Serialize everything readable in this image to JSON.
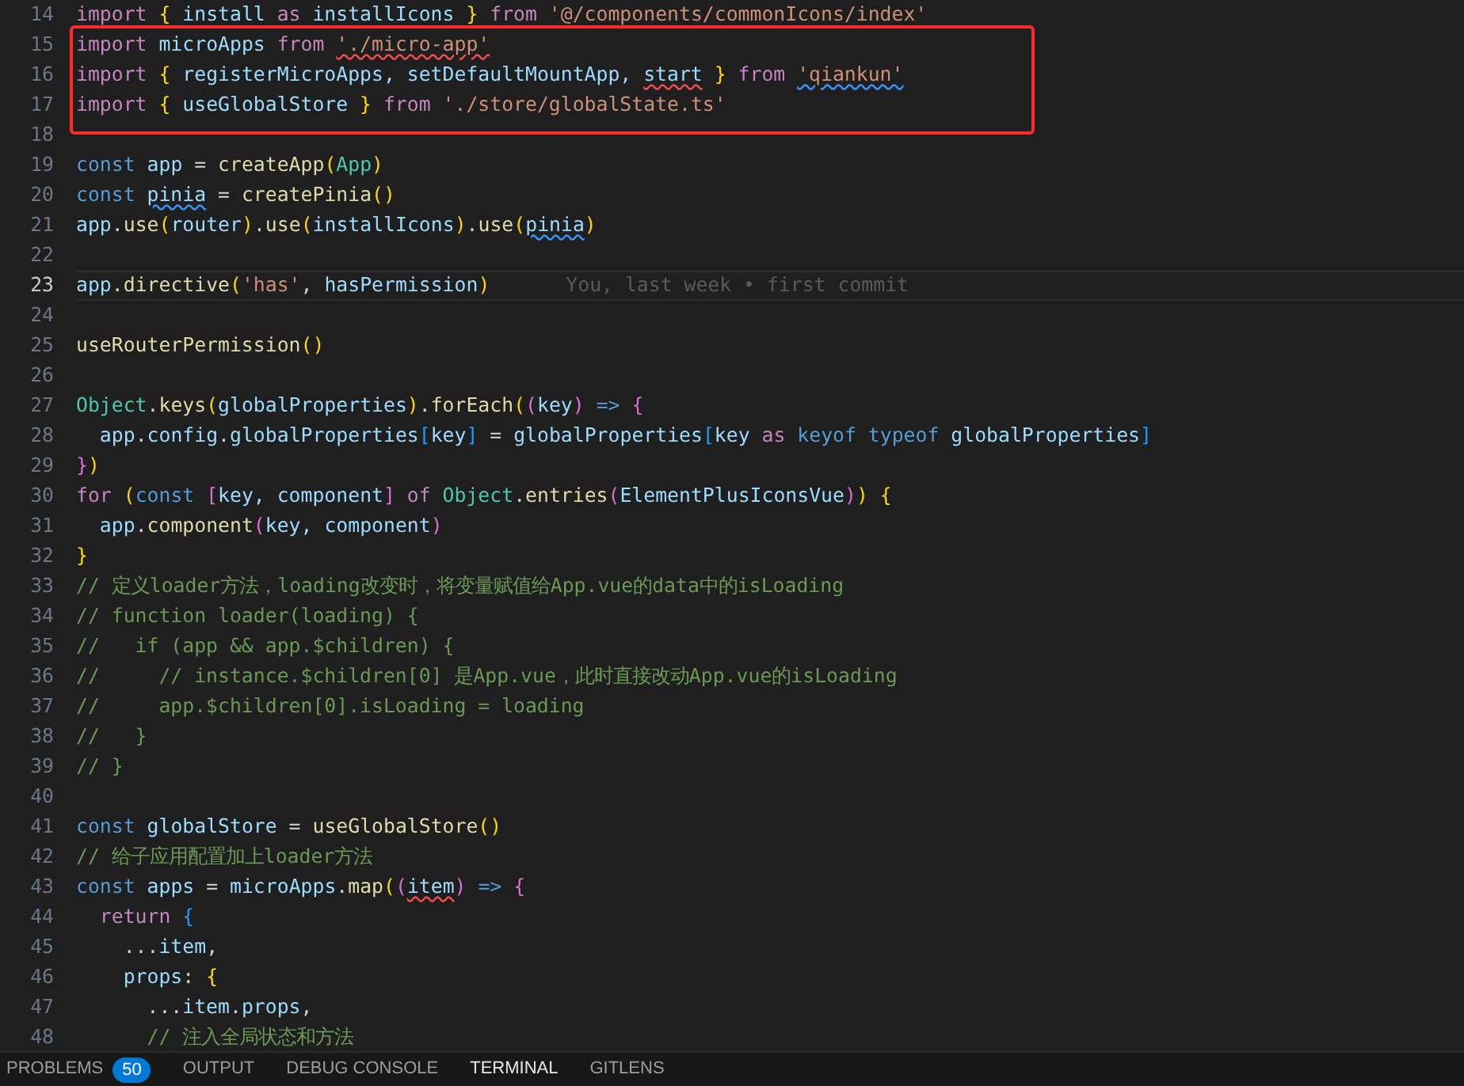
{
  "editor": {
    "blocks": [
      {
        "framed": false,
        "lines": [
          {
            "number": "14",
            "current": false,
            "tokens": [
              {
                "t": "import",
                "kind": "control"
              },
              {
                "t": " {",
                "kind": "bracket1"
              },
              {
                "t": " install ",
                "kind": "variable"
              },
              {
                "t": "as",
                "kind": "control"
              },
              {
                "t": " installIcons ",
                "kind": "variable"
              },
              {
                "t": "}",
                "kind": "bracket1"
              },
              {
                "t": " from",
                "kind": "control"
              },
              {
                "t": " '@/components/commonIcons/index'",
                "kind": "string"
              }
            ]
          }
        ]
      },
      {
        "framed": true,
        "lines": [
          {
            "number": "15",
            "current": false,
            "tokens": [
              {
                "t": "import",
                "kind": "control"
              },
              {
                "t": " microApps",
                "kind": "variable"
              },
              {
                "t": " from ",
                "kind": "control"
              },
              {
                "t": "'./micro-app'",
                "kind": "string",
                "error": true
              }
            ]
          },
          {
            "number": "16",
            "current": false,
            "tokens": [
              {
                "t": "import",
                "kind": "control"
              },
              {
                "t": " {",
                "kind": "bracket1"
              },
              {
                "t": " registerMicroApps, setDefaultMountApp, ",
                "kind": "variable"
              },
              {
                "t": "start",
                "kind": "variable",
                "error": true
              },
              {
                "t": " }",
                "kind": "bracket1"
              },
              {
                "t": " from ",
                "kind": "control"
              },
              {
                "t": "'qiankun'",
                "kind": "string",
                "warning": true
              }
            ]
          },
          {
            "number": "17",
            "current": false,
            "tokens": [
              {
                "t": "import",
                "kind": "control"
              },
              {
                "t": " {",
                "kind": "bracket1"
              },
              {
                "t": " useGlobalStore",
                "kind": "variable"
              },
              {
                "t": " }",
                "kind": "bracket1"
              },
              {
                "t": " from",
                "kind": "control"
              },
              {
                "t": " './store/globalState.ts'",
                "kind": "string"
              }
            ]
          }
        ]
      },
      {
        "framed": false,
        "lines": [
          {
            "number": "18",
            "current": false
          },
          {
            "number": "19",
            "current": false,
            "tokens": [
              {
                "t": "const",
                "kind": "keyword"
              },
              {
                "t": " app",
                "kind": "variable"
              },
              {
                "t": " = ",
                "kind": "plain"
              },
              {
                "t": "createApp",
                "kind": "function"
              },
              {
                "t": "(",
                "kind": "bracket1"
              },
              {
                "t": "App",
                "kind": "type"
              },
              {
                "t": ")",
                "kind": "bracket1"
              }
            ]
          },
          {
            "number": "20",
            "current": false,
            "tokens": [
              {
                "t": "const ",
                "kind": "keyword"
              },
              {
                "t": "pinia",
                "kind": "variable",
                "warning": true
              },
              {
                "t": " = ",
                "kind": "plain"
              },
              {
                "t": "createPinia",
                "kind": "function"
              },
              {
                "t": "()",
                "kind": "bracket1"
              }
            ]
          },
          {
            "number": "21",
            "current": false,
            "tokens": [
              {
                "t": "app",
                "kind": "variable"
              },
              {
                "t": ".",
                "kind": "plain"
              },
              {
                "t": "use",
                "kind": "function"
              },
              {
                "t": "(",
                "kind": "bracket1"
              },
              {
                "t": "router",
                "kind": "variable"
              },
              {
                "t": ")",
                "kind": "bracket1"
              },
              {
                "t": ".",
                "kind": "plain"
              },
              {
                "t": "use",
                "kind": "function"
              },
              {
                "t": "(",
                "kind": "bracket1"
              },
              {
                "t": "installIcons",
                "kind": "variable"
              },
              {
                "t": ")",
                "kind": "bracket1"
              },
              {
                "t": ".",
                "kind": "plain"
              },
              {
                "t": "use",
                "kind": "function"
              },
              {
                "t": "(",
                "kind": "bracket1"
              },
              {
                "t": "pinia",
                "kind": "variable",
                "warning": true
              },
              {
                "t": ")",
                "kind": "bracket1"
              }
            ]
          },
          {
            "number": "22",
            "current": false
          },
          {
            "number": "23",
            "current": true,
            "blame": "You, last week • first commit",
            "tokens": [
              {
                "t": "app",
                "kind": "variable"
              },
              {
                "t": ".",
                "kind": "plain"
              },
              {
                "t": "directive",
                "kind": "function"
              },
              {
                "t": "(",
                "kind": "bracket1"
              },
              {
                "t": "'has'",
                "kind": "string"
              },
              {
                "t": ",",
                "kind": "plain"
              },
              {
                "t": " hasPermission",
                "kind": "variable"
              },
              {
                "t": ")",
                "kind": "bracket1"
              }
            ]
          },
          {
            "number": "24",
            "current": false
          },
          {
            "number": "25",
            "current": false,
            "tokens": [
              {
                "t": "useRouterPermission",
                "kind": "function"
              },
              {
                "t": "()",
                "kind": "bracket1"
              }
            ]
          },
          {
            "number": "26",
            "current": false
          },
          {
            "number": "27",
            "current": false,
            "tokens": [
              {
                "t": "Object",
                "kind": "type"
              },
              {
                "t": ".",
                "kind": "plain"
              },
              {
                "t": "keys",
                "kind": "function"
              },
              {
                "t": "(",
                "kind": "bracket1"
              },
              {
                "t": "globalProperties",
                "kind": "variable"
              },
              {
                "t": ")",
                "kind": "bracket1"
              },
              {
                "t": ".",
                "kind": "plain"
              },
              {
                "t": "forEach",
                "kind": "function"
              },
              {
                "t": "(",
                "kind": "bracket1"
              },
              {
                "t": "(",
                "kind": "bracket2"
              },
              {
                "t": "key",
                "kind": "variable"
              },
              {
                "t": ")",
                "kind": "bracket2"
              },
              {
                "t": " =>",
                "kind": "keyword"
              },
              {
                "t": " {",
                "kind": "bracket2"
              }
            ]
          },
          {
            "number": "28",
            "current": false,
            "tokens": [
              {
                "t": "  app",
                "kind": "variable"
              },
              {
                "t": ".",
                "kind": "plain"
              },
              {
                "t": "config",
                "kind": "variable"
              },
              {
                "t": ".",
                "kind": "plain"
              },
              {
                "t": "globalProperties",
                "kind": "variable"
              },
              {
                "t": "[",
                "kind": "bracket3"
              },
              {
                "t": "key",
                "kind": "variable"
              },
              {
                "t": "]",
                "kind": "bracket3"
              },
              {
                "t": " = ",
                "kind": "plain"
              },
              {
                "t": "globalProperties",
                "kind": "variable"
              },
              {
                "t": "[",
                "kind": "bracket3"
              },
              {
                "t": "key",
                "kind": "variable"
              },
              {
                "t": " as",
                "kind": "control"
              },
              {
                "t": " keyof typeof",
                "kind": "keyword"
              },
              {
                "t": " globalProperties",
                "kind": "variable"
              },
              {
                "t": "]",
                "kind": "bracket3"
              }
            ]
          },
          {
            "number": "29",
            "current": false,
            "tokens": [
              {
                "t": "}",
                "kind": "bracket2"
              },
              {
                "t": ")",
                "kind": "bracket1"
              }
            ]
          },
          {
            "number": "30",
            "current": false,
            "tokens": [
              {
                "t": "for",
                "kind": "control"
              },
              {
                "t": " (",
                "kind": "bracket1"
              },
              {
                "t": "const",
                "kind": "keyword"
              },
              {
                "t": " [",
                "kind": "bracket2"
              },
              {
                "t": "key, component",
                "kind": "variable"
              },
              {
                "t": "]",
                "kind": "bracket2"
              },
              {
                "t": " of",
                "kind": "control"
              },
              {
                "t": " Object",
                "kind": "type"
              },
              {
                "t": ".",
                "kind": "plain"
              },
              {
                "t": "entries",
                "kind": "function"
              },
              {
                "t": "(",
                "kind": "bracket2"
              },
              {
                "t": "ElementPlusIconsVue",
                "kind": "variable"
              },
              {
                "t": ")",
                "kind": "bracket2"
              },
              {
                "t": ")",
                "kind": "bracket1"
              },
              {
                "t": " {",
                "kind": "bracket1"
              }
            ]
          },
          {
            "number": "31",
            "current": false,
            "tokens": [
              {
                "t": "  app",
                "kind": "variable"
              },
              {
                "t": ".",
                "kind": "plain"
              },
              {
                "t": "component",
                "kind": "function"
              },
              {
                "t": "(",
                "kind": "bracket2"
              },
              {
                "t": "key, component",
                "kind": "variable"
              },
              {
                "t": ")",
                "kind": "bracket2"
              }
            ]
          },
          {
            "number": "32",
            "current": false,
            "tokens": [
              {
                "t": "}",
                "kind": "bracket1"
              }
            ]
          },
          {
            "number": "33",
            "current": false,
            "tokens": [
              {
                "t": "// 定义loader方法，loading改变时，将变量赋值给App.vue的data中的isLoading",
                "kind": "comment"
              }
            ]
          },
          {
            "number": "34",
            "current": false,
            "tokens": [
              {
                "t": "// function loader(loading) {",
                "kind": "comment"
              }
            ]
          },
          {
            "number": "35",
            "current": false,
            "tokens": [
              {
                "t": "//   if (app && app.$children) {",
                "kind": "comment"
              }
            ]
          },
          {
            "number": "36",
            "current": false,
            "tokens": [
              {
                "t": "//     // instance.$children[0] 是App.vue，此时直接改动App.vue的isLoading",
                "kind": "comment"
              }
            ]
          },
          {
            "number": "37",
            "current": false,
            "tokens": [
              {
                "t": "//     app.$children[0].isLoading = loading",
                "kind": "comment"
              }
            ]
          },
          {
            "number": "38",
            "current": false,
            "tokens": [
              {
                "t": "//   }",
                "kind": "comment"
              }
            ]
          },
          {
            "number": "39",
            "current": false,
            "tokens": [
              {
                "t": "// }",
                "kind": "comment"
              }
            ]
          },
          {
            "number": "40",
            "current": false
          },
          {
            "number": "41",
            "current": false,
            "tokens": [
              {
                "t": "const",
                "kind": "keyword"
              },
              {
                "t": " globalStore",
                "kind": "variable"
              },
              {
                "t": " = ",
                "kind": "plain"
              },
              {
                "t": "useGlobalStore",
                "kind": "function"
              },
              {
                "t": "()",
                "kind": "bracket1"
              }
            ]
          },
          {
            "number": "42",
            "current": false,
            "tokens": [
              {
                "t": "// 给子应用配置加上loader方法",
                "kind": "comment"
              }
            ]
          },
          {
            "number": "43",
            "current": false,
            "tokens": [
              {
                "t": "const",
                "kind": "keyword"
              },
              {
                "t": " apps",
                "kind": "variable"
              },
              {
                "t": " = ",
                "kind": "plain"
              },
              {
                "t": "microApps",
                "kind": "variable"
              },
              {
                "t": ".",
                "kind": "plain"
              },
              {
                "t": "map",
                "kind": "function"
              },
              {
                "t": "(",
                "kind": "bracket1"
              },
              {
                "t": "(",
                "kind": "bracket2"
              },
              {
                "t": "item",
                "kind": "variable",
                "error": true
              },
              {
                "t": ")",
                "kind": "bracket2"
              },
              {
                "t": " =>",
                "kind": "keyword"
              },
              {
                "t": " {",
                "kind": "bracket2"
              }
            ]
          },
          {
            "number": "44",
            "current": false,
            "tokens": [
              {
                "t": "  return",
                "kind": "control"
              },
              {
                "t": " {",
                "kind": "bracket3"
              }
            ]
          },
          {
            "number": "45",
            "current": false,
            "tokens": [
              {
                "t": "    ...",
                "kind": "plain"
              },
              {
                "t": "item",
                "kind": "variable"
              },
              {
                "t": ",",
                "kind": "plain"
              }
            ]
          },
          {
            "number": "46",
            "current": false,
            "tokens": [
              {
                "t": "    props",
                "kind": "variable"
              },
              {
                "t": ":",
                "kind": "plain"
              },
              {
                "t": " {",
                "kind": "bracket1"
              }
            ]
          },
          {
            "number": "47",
            "current": false,
            "tokens": [
              {
                "t": "      ...",
                "kind": "plain"
              },
              {
                "t": "item",
                "kind": "variable"
              },
              {
                "t": ".",
                "kind": "plain"
              },
              {
                "t": "props",
                "kind": "variable"
              },
              {
                "t": ",",
                "kind": "plain"
              }
            ]
          },
          {
            "number": "48",
            "current": false,
            "tokens": [
              {
                "t": "      // 注入全局状态和方法",
                "kind": "comment"
              }
            ]
          }
        ]
      }
    ]
  },
  "panel": {
    "tabs": [
      {
        "label": "PROBLEMS",
        "badge": "50",
        "selected": false
      },
      {
        "label": "OUTPUT",
        "selected": false
      },
      {
        "label": "DEBUG CONSOLE",
        "selected": false
      },
      {
        "label": "TERMINAL",
        "selected": true
      },
      {
        "label": "GITLENS",
        "selected": false
      }
    ]
  }
}
